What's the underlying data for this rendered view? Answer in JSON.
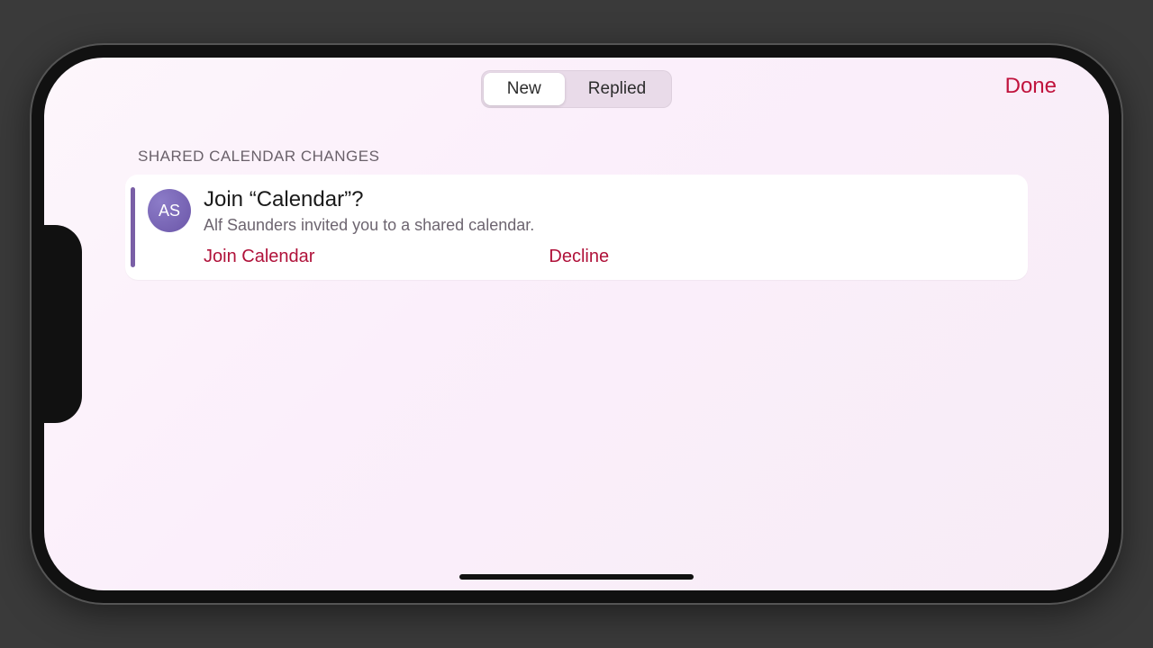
{
  "header": {
    "segments": {
      "new": "New",
      "replied": "Replied"
    },
    "active_segment": "new",
    "done_label": "Done"
  },
  "section": {
    "title": "SHARED CALENDAR CHANGES"
  },
  "invite": {
    "avatar_initials": "AS",
    "title": "Join “Calendar”?",
    "subtitle": "Alf Saunders invited you to a shared calendar.",
    "join_label": "Join Calendar",
    "decline_label": "Decline",
    "accent_color": "#7a5fa6"
  }
}
